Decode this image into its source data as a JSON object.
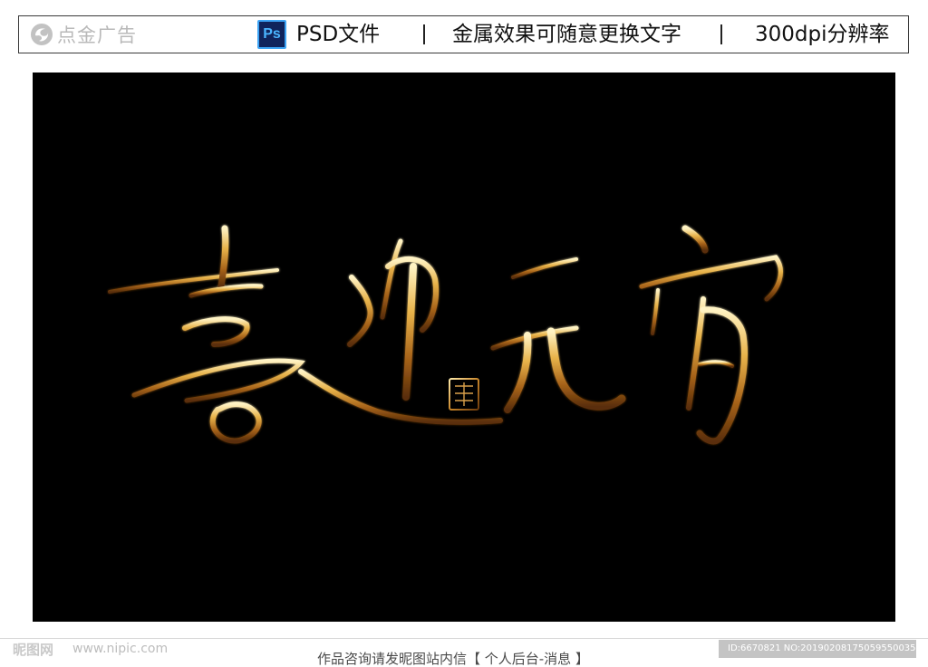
{
  "header": {
    "brand_name": "点金广告",
    "brand_logo_icon": "swirl-logo-icon",
    "ps_badge": "Ps",
    "file_type": "PSD文件",
    "feature": "金属效果可随意更换文字",
    "resolution": "300dpi分辨率"
  },
  "artwork": {
    "calligraphy_text": "喜迎元宵",
    "seal_text": "元宵佳节",
    "background_color": "#000000",
    "gold_color": "#c8902c"
  },
  "footer": {
    "watermark_brand": "昵图网",
    "watermark_url": "www.nipic.com",
    "notice": "作品咨询请发昵图站内信【 个人后台-消息 】",
    "image_id": "ID:6670821 NO:20190208175059550035"
  }
}
